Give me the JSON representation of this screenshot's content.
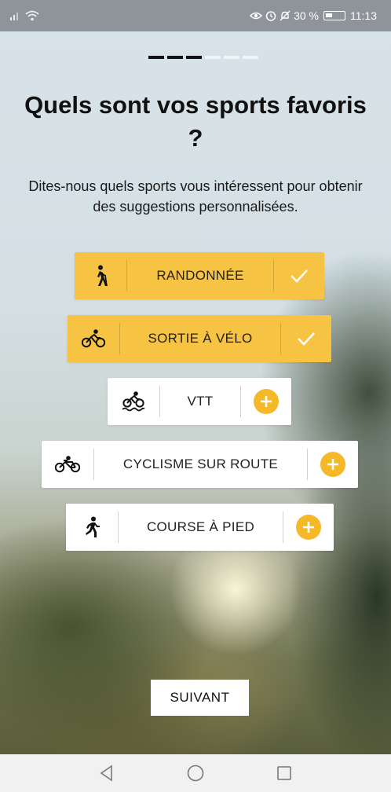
{
  "status_bar": {
    "battery_text": "30 %",
    "time": "11:13"
  },
  "progress": {
    "total_steps": 6,
    "current_step": 3
  },
  "heading": {
    "title": "Quels sont vos sports favoris ?",
    "subtitle": "Dites-nous quels sports vous intéressent pour obtenir des suggestions personnalisées."
  },
  "sports": [
    {
      "label": "RANDONNÉE",
      "icon": "hiking-icon",
      "selected": true
    },
    {
      "label": "SORTIE À VÉLO",
      "icon": "bicycle-ride-icon",
      "selected": true
    },
    {
      "label": "VTT",
      "icon": "mountain-bike-icon",
      "selected": false
    },
    {
      "label": "CYCLISME SUR ROUTE",
      "icon": "road-bike-icon",
      "selected": false
    },
    {
      "label": "COURSE À PIED",
      "icon": "running-icon",
      "selected": false
    }
  ],
  "next_button": {
    "label": "SUIVANT"
  },
  "colors": {
    "accent": "#f6c342",
    "plus": "#f5b829",
    "text": "#111111"
  }
}
